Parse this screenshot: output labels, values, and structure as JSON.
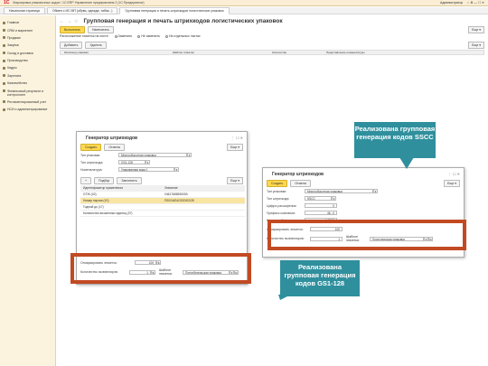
{
  "window": {
    "title": "Маркировка упаковочных кодов / 1С:ERP Управление предприятием 2 (1С:Предприятие)",
    "right_user": "Администратор",
    "right_icons": "☆  ⚙  —  ☐  ✕"
  },
  "tabs": [
    "Начальная страница",
    "Обмен с ИС МП (обувь, одежда, табак...)",
    "Групповая генерация и печать штрихкодов логистических упаковок"
  ],
  "sidebar": [
    "Главное",
    "CRM и маркетинг",
    "Продажи",
    "Закупки",
    "Склад и доставка",
    "Производство",
    "Кадры",
    "Зарплата",
    "Казначейство",
    "Финансовый результат и контроллинг",
    "Регламентированный учет",
    "НСИ и администрирование"
  ],
  "main": {
    "title": "Групповая генерация и печать штрихкодов логистических упаковок",
    "buttons": [
      "Выполнить",
      "Напечатать"
    ],
    "radio_label": "Расположение этикеток на листе:",
    "radios": [
      "Заменить",
      "Не заменить",
      "На отдельных листах"
    ],
    "table_buttons": [
      "Добавить",
      "Удалить"
    ],
    "more": "Еще ▾",
    "columns": [
      "Штрихкод упаковки",
      "Шаблон этикетки",
      "Количество",
      "Представление номенклатуры"
    ]
  },
  "dlg1": {
    "title": "Генератор штрихкодов",
    "buttons": [
      "Создать",
      "Отмена"
    ],
    "more": "Еще ▾",
    "fields": [
      {
        "label": "Тип упаковки:",
        "value": "Многооборотная упаковка"
      },
      {
        "label": "Тип штрихкода:",
        "value": "GS1-128"
      },
      {
        "label": "Номенклатура:",
        "value": "Упакованная вода 1"
      }
    ],
    "table_buttons": [
      "Подбор",
      "Заполнить"
    ],
    "columns": [
      "Идентификатор применения",
      "Значение"
    ],
    "rows": [
      [
        "GTIN (02)",
        "04617688530050"
      ],
      [
        "Номер партии (10)",
        "П00/16/04/2020/02/28"
      ],
      [
        "Годный до (17)",
        ""
      ],
      [
        "Количество вложенных единиц (37)",
        ""
      ]
    ],
    "count_label": "Отмаркировать этикеток:",
    "count_value": "100",
    "print_label": "Количество экземпляров:",
    "print_value": "1",
    "template_label": "Шаблон этикетки:",
    "template_value": "Потребительская упаковка"
  },
  "dlg2": {
    "title": "Генератор штрихкодов",
    "buttons": [
      "Создать",
      "Отмена"
    ],
    "more": "Еще ▾",
    "fields": [
      {
        "label": "Тип упаковки:",
        "value": "Многооборотная упаковка"
      },
      {
        "label": "Тип штрихкода:",
        "value": "SSCC"
      },
      {
        "label": "Цифра расширения:",
        "value": "0"
      },
      {
        "label": "Префикс компании:",
        "value": "46...0"
      },
      {
        "label": "Начальный номер:",
        "value": "1  2345"
      }
    ],
    "count_label": "Отмаркировать этикеток:",
    "count_value": "100",
    "print_label": "Количество экземпляров:",
    "print_value": "1",
    "template_label": "Шаблон этикетки:",
    "template_value": "Логистическая упаковка"
  },
  "callouts": {
    "sscc": "Реализована групповая генерация кодов SSCC",
    "gs1": "Реализована групповая генерация кодов GS1-128"
  },
  "colors": {
    "callout": "#2f8f9d",
    "highlight": "#c24a23",
    "button_primary": "#ffd84d",
    "sidebar": "#fbf3dd"
  }
}
